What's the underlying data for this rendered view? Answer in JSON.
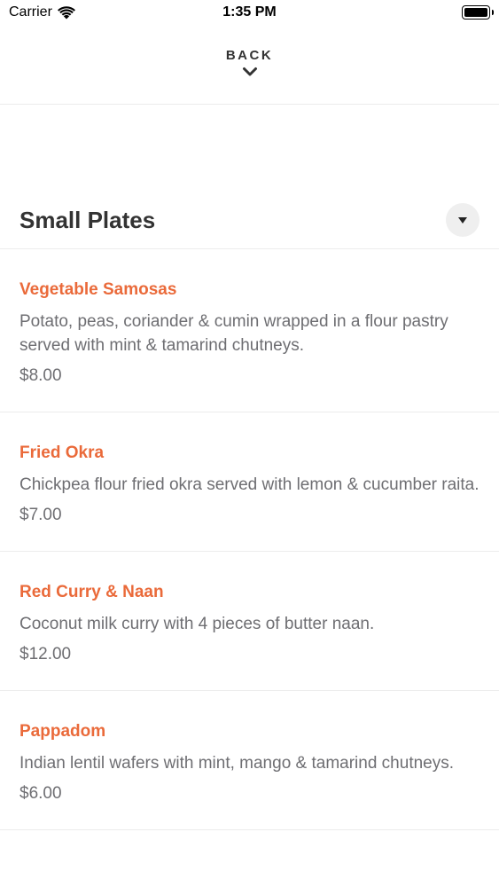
{
  "status_bar": {
    "carrier": "Carrier",
    "time": "1:35 PM",
    "icons": [
      "wifi-icon",
      "battery-icon"
    ]
  },
  "nav": {
    "back_label": "BACK",
    "back_icon": "chevron-down-icon"
  },
  "section": {
    "title": "Small Plates",
    "toggle_icon": "caret-down-icon"
  },
  "colors": {
    "accent": "#ea6a3a",
    "text_primary": "#333333",
    "text_secondary": "#6e6e72",
    "divider": "#ececec"
  },
  "menu_items": [
    {
      "name": "Vegetable Samosas",
      "description": "Potato, peas, coriander & cumin wrapped in a flour pastry served with mint & tamarind chutneys.",
      "price": "$8.00"
    },
    {
      "name": "Fried Okra",
      "description": "Chickpea flour fried okra served with lemon & cucumber raita.",
      "price": "$7.00"
    },
    {
      "name": "Red Curry & Naan",
      "description": "Coconut milk curry with 4 pieces of butter naan.",
      "price": "$12.00"
    },
    {
      "name": "Pappadom",
      "description": "Indian lentil wafers with mint, mango & tamarind chutneys.",
      "price": "$6.00"
    }
  ]
}
